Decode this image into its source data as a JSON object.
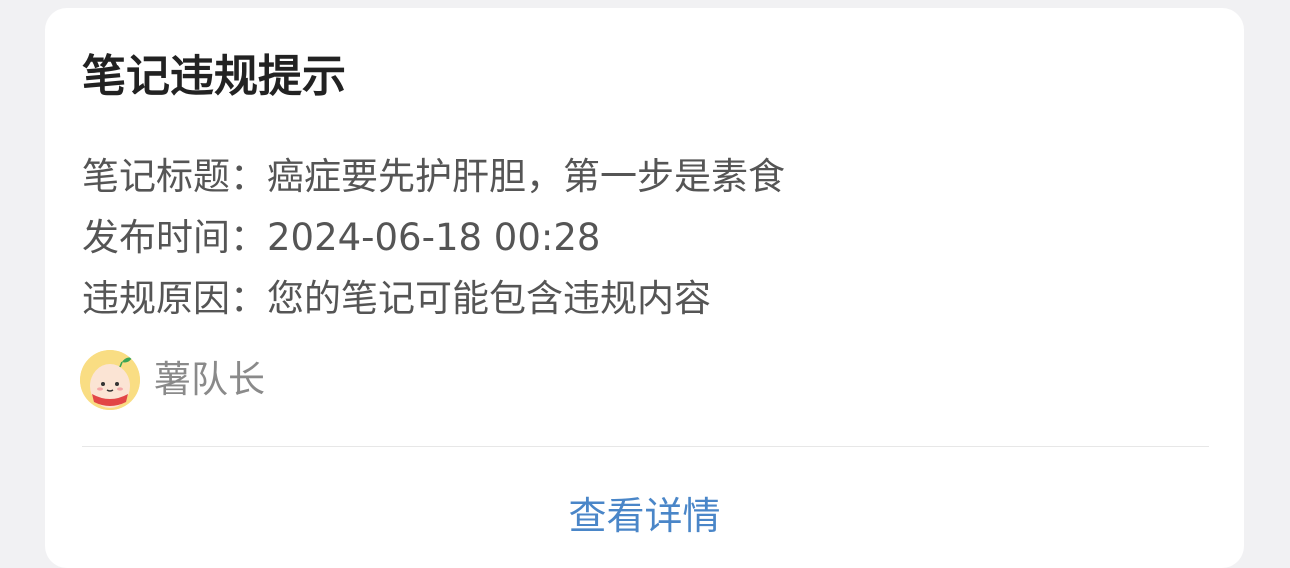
{
  "card": {
    "title": "笔记违规提示",
    "rows": [
      {
        "text": "笔记标题：癌症要先护肝胆，第一步是素食"
      },
      {
        "text": "发布时间：2024-06-18 00:28"
      },
      {
        "text": "违规原因：您的笔记可能包含违规内容"
      }
    ],
    "author": {
      "name": "薯队长",
      "avatar_icon": "potato-mascot-icon"
    },
    "action_label": "查看详情"
  },
  "colors": {
    "title": "#222222",
    "body_text": "#555555",
    "author_text": "#8a8a8a",
    "link": "#4a86c8",
    "avatar_bg": "#f9dd83"
  }
}
